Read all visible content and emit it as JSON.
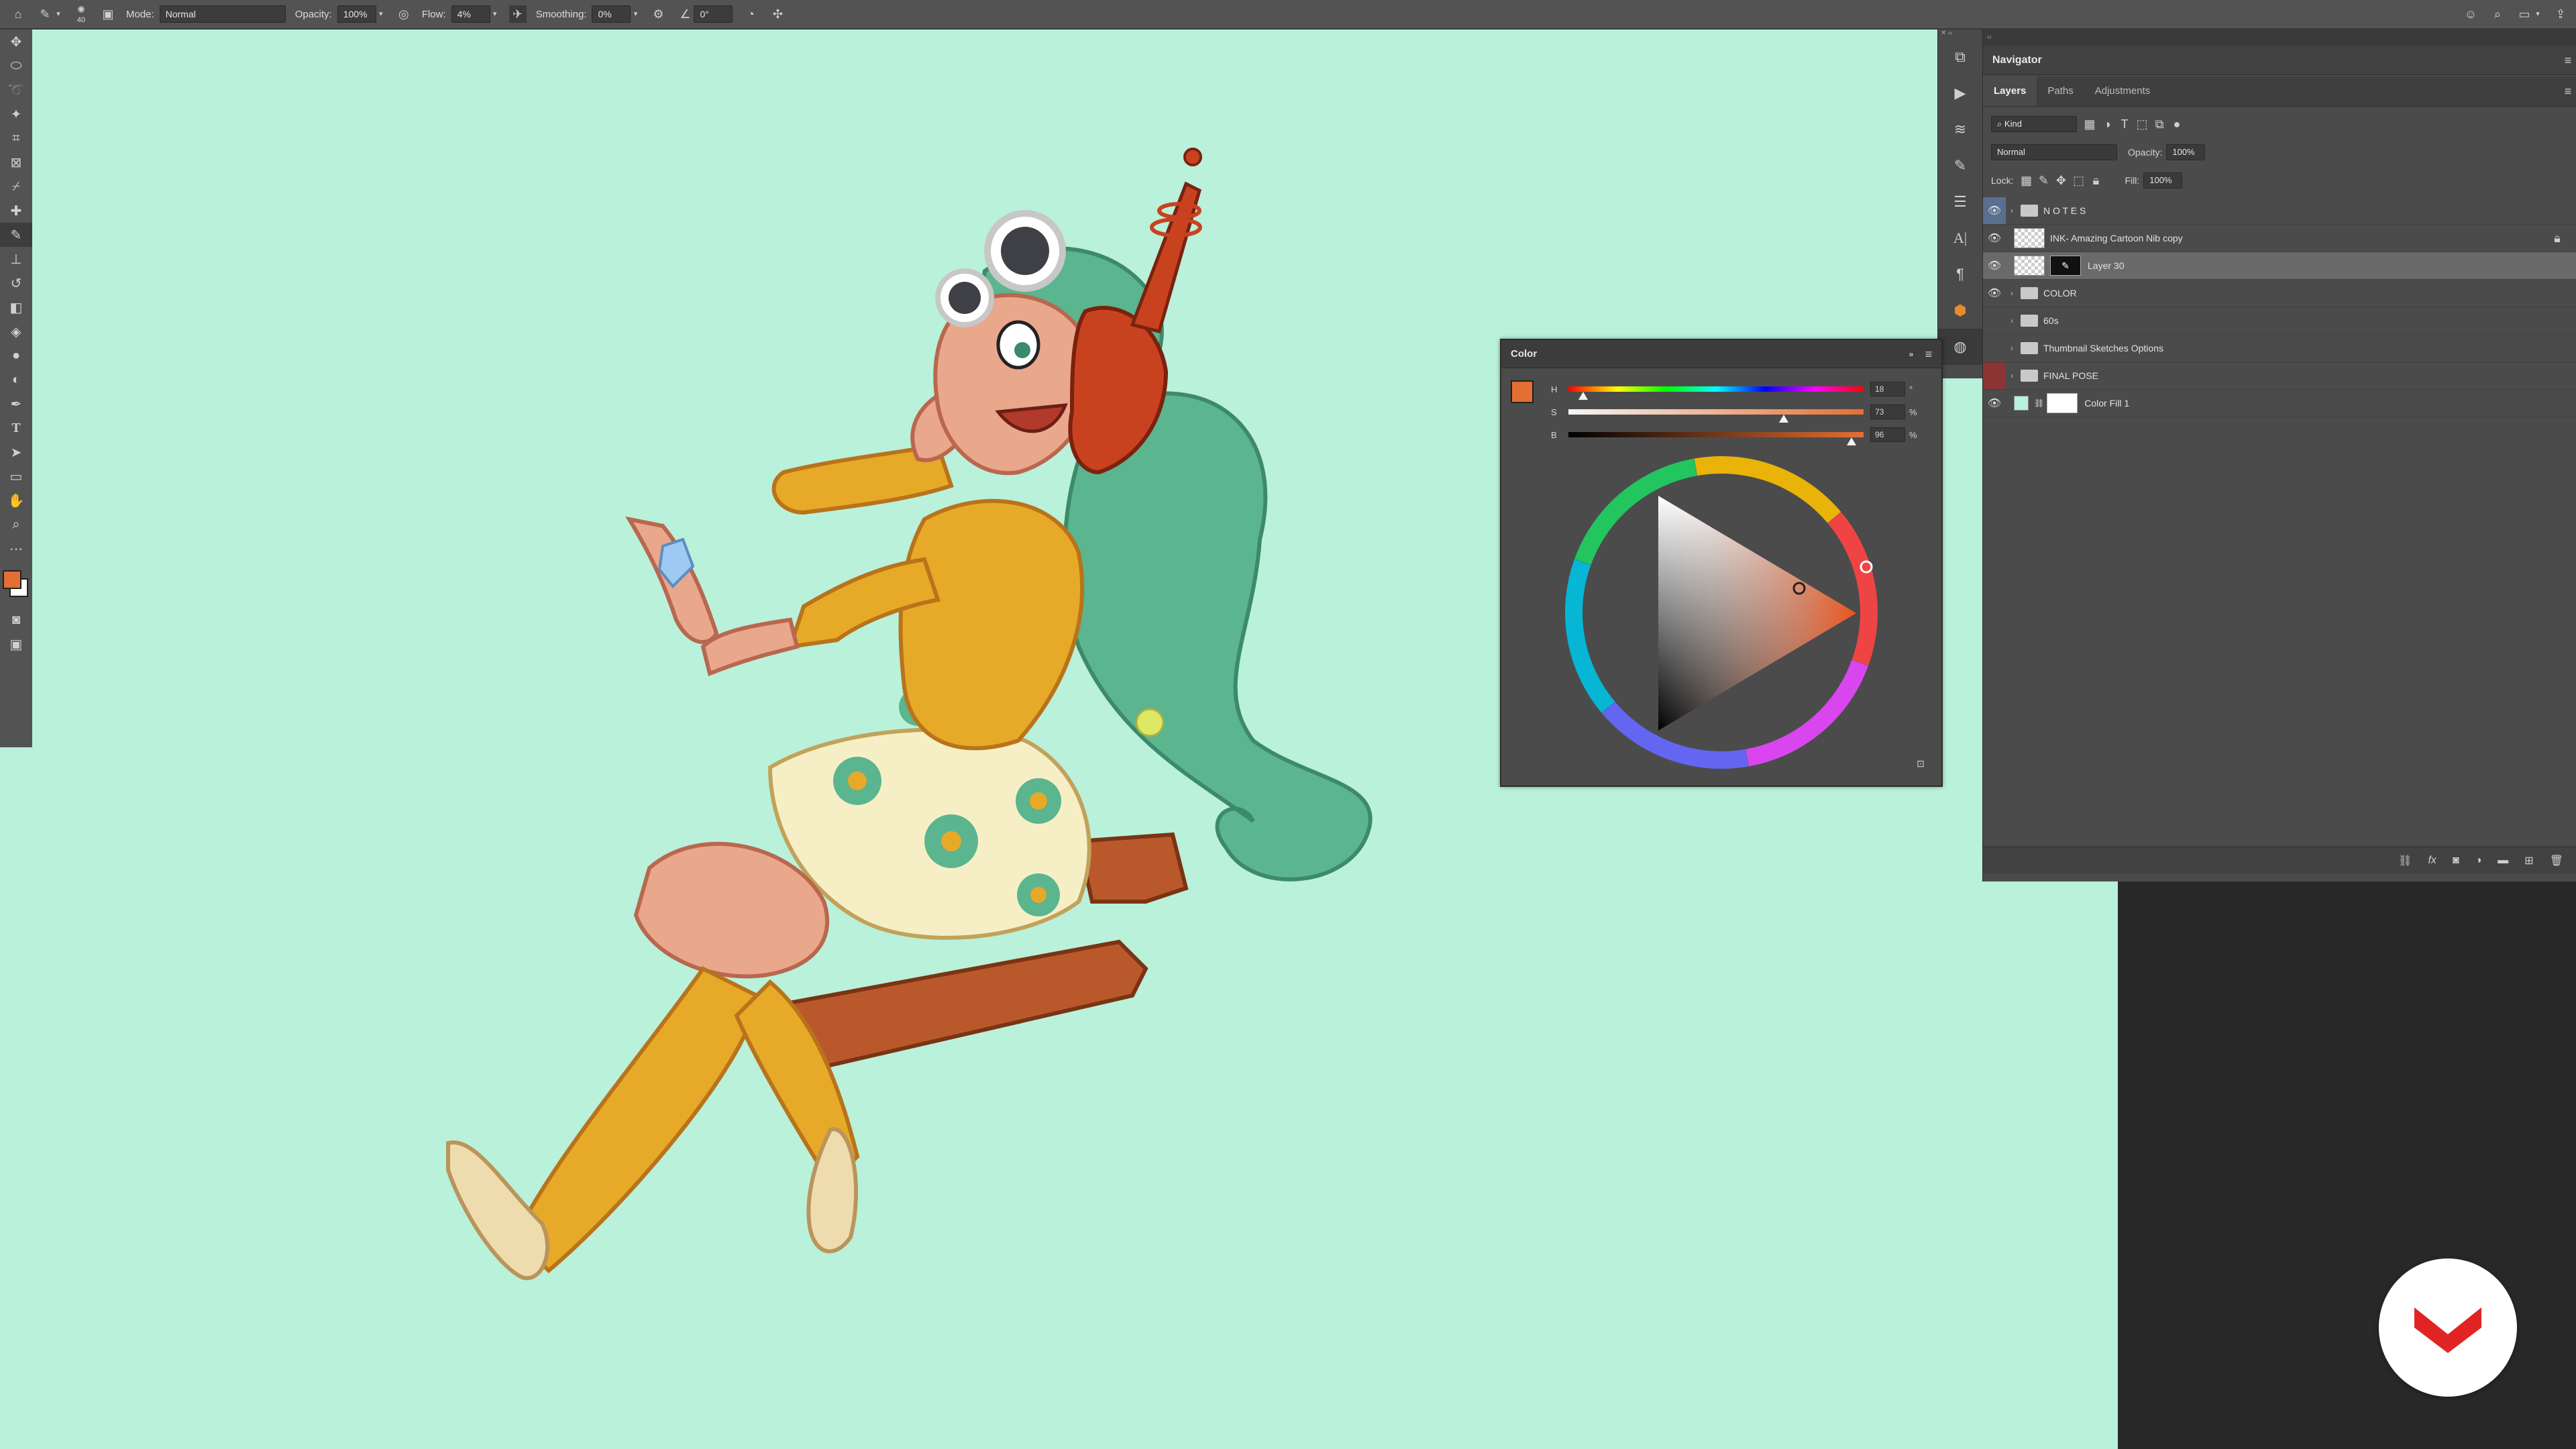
{
  "options_bar": {
    "brush_size": "40",
    "mode_label": "Mode:",
    "mode_value": "Normal",
    "opacity_label": "Opacity:",
    "opacity_value": "100%",
    "flow_label": "Flow:",
    "flow_value": "4%",
    "smoothing_label": "Smoothing:",
    "smoothing_value": "0%",
    "angle_value": "0°"
  },
  "navigator": {
    "title": "Navigator"
  },
  "layers_panel": {
    "tabs": [
      "Layers",
      "Paths",
      "Adjustments"
    ],
    "filter_kind": "Kind",
    "blend_mode": "Normal",
    "opacity_label": "Opacity:",
    "opacity_value": "100%",
    "lock_label": "Lock:",
    "fill_label": "Fill:",
    "fill_value": "100%",
    "layers": [
      {
        "name": "N O T E S",
        "type": "group",
        "visible": true
      },
      {
        "name": "INK- Amazing Cartoon Nib copy",
        "type": "pixel",
        "visible": true,
        "locked": true
      },
      {
        "name": "Layer 30",
        "type": "pixel-mask",
        "visible": true,
        "selected": true
      },
      {
        "name": "COLOR",
        "type": "group",
        "visible": true
      },
      {
        "name": "60s",
        "type": "group",
        "visible": false
      },
      {
        "name": "Thumbnail Sketches Options",
        "type": "group",
        "visible": false
      },
      {
        "name": "FINAL POSE",
        "type": "group",
        "visible": false,
        "color_tag": "red"
      },
      {
        "name": "Color Fill 1",
        "type": "fill",
        "visible": true
      }
    ]
  },
  "color_panel": {
    "title": "Color",
    "h_label": "H",
    "h_value": "18",
    "h_unit": "°",
    "h_fraction": 0.05,
    "s_label": "S",
    "s_value": "73",
    "s_unit": "%",
    "s_fraction": 0.73,
    "b_label": "B",
    "b_value": "96",
    "b_unit": "%",
    "b_fraction": 0.96,
    "foreground_color": "#e36f33"
  },
  "colors": {
    "canvas_bg": "#b9f1db",
    "panel_bg": "#4b4b4b",
    "foreground": "#e36f33",
    "logo_red": "#e02424"
  },
  "tools": [
    "move-icon",
    "marquee-icon",
    "lasso-icon",
    "magic-wand-icon",
    "crop-icon",
    "frame-icon",
    "eyedropper-icon",
    "healing-icon",
    "brush-icon",
    "stamp-icon",
    "history-brush-icon",
    "eraser-icon",
    "bucket-icon",
    "blur-icon",
    "dodge-icon",
    "pen-icon",
    "type-icon",
    "path-select-icon",
    "rectangle-icon",
    "hand-icon",
    "zoom-icon",
    "more-icon"
  ]
}
